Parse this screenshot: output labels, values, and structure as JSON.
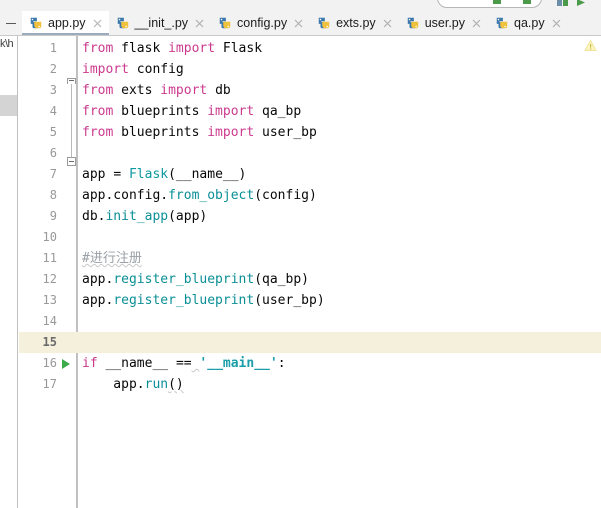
{
  "window": {
    "app": "PyCharm",
    "active_file": "app.py"
  },
  "toolbar": {
    "search_placeholder": "",
    "icons": [
      {
        "name": "run-config-icon",
        "color": "#4a9a4a"
      },
      {
        "name": "run-icon",
        "color": "#4a9a4a"
      },
      {
        "name": "flag-icon-1",
        "color": "#4a9a4a"
      },
      {
        "name": "flag-icon-2",
        "color": "#4a9a4a"
      }
    ]
  },
  "left_panel": {
    "clipped_label": "k\\h"
  },
  "tabs": {
    "hide_label": "",
    "close_label": "×",
    "items": [
      {
        "label": "app.py",
        "active": true
      },
      {
        "label": "__init_.py",
        "active": false
      },
      {
        "label": "config.py",
        "active": false
      },
      {
        "label": "exts.py",
        "active": false
      },
      {
        "label": "user.py",
        "active": false
      },
      {
        "label": "qa.py",
        "active": false
      }
    ]
  },
  "editor": {
    "language": "python",
    "current_line": 15,
    "run_marker_line": 16,
    "fold_lines": [
      1,
      5
    ],
    "warning_badge": "warning-triangle-icon",
    "line_count": 17,
    "lines": [
      {
        "n": 1,
        "tokens": [
          {
            "t": "from",
            "c": "kw2"
          },
          {
            "t": " flask ",
            "c": "plain"
          },
          {
            "t": "import",
            "c": "kw2"
          },
          {
            "t": " Flask",
            "c": "plain"
          }
        ]
      },
      {
        "n": 2,
        "tokens": [
          {
            "t": "import",
            "c": "kw2"
          },
          {
            "t": " config",
            "c": "plain"
          }
        ]
      },
      {
        "n": 3,
        "tokens": [
          {
            "t": "from",
            "c": "kw2"
          },
          {
            "t": " exts ",
            "c": "plain"
          },
          {
            "t": "import",
            "c": "kw2"
          },
          {
            "t": " db",
            "c": "plain"
          }
        ]
      },
      {
        "n": 4,
        "tokens": [
          {
            "t": "from",
            "c": "kw2"
          },
          {
            "t": " blueprints ",
            "c": "plain"
          },
          {
            "t": "import",
            "c": "kw2"
          },
          {
            "t": " qa_bp",
            "c": "plain"
          }
        ]
      },
      {
        "n": 5,
        "tokens": [
          {
            "t": "from",
            "c": "kw2"
          },
          {
            "t": " blueprints ",
            "c": "plain"
          },
          {
            "t": "import",
            "c": "kw2"
          },
          {
            "t": " user_bp",
            "c": "plain"
          }
        ]
      },
      {
        "n": 6,
        "tokens": []
      },
      {
        "n": 7,
        "tokens": [
          {
            "t": "app ",
            "c": "plain"
          },
          {
            "t": "=",
            "c": "plain"
          },
          {
            "t": " ",
            "c": "plain"
          },
          {
            "t": "Flask",
            "c": "cls"
          },
          {
            "t": "(__name__)",
            "c": "plain"
          }
        ]
      },
      {
        "n": 8,
        "tokens": [
          {
            "t": "app.config.",
            "c": "plain"
          },
          {
            "t": "from_object",
            "c": "fn"
          },
          {
            "t": "(config)",
            "c": "plain"
          }
        ]
      },
      {
        "n": 9,
        "tokens": [
          {
            "t": "db.",
            "c": "plain"
          },
          {
            "t": "init_app",
            "c": "fn"
          },
          {
            "t": "(app)",
            "c": "plain"
          }
        ]
      },
      {
        "n": 10,
        "tokens": []
      },
      {
        "n": 11,
        "tokens": [
          {
            "t": "#进行注册",
            "c": "cmt squig"
          }
        ]
      },
      {
        "n": 12,
        "tokens": [
          {
            "t": "app.",
            "c": "plain"
          },
          {
            "t": "register_blueprint",
            "c": "fn"
          },
          {
            "t": "(qa_bp)",
            "c": "plain"
          }
        ]
      },
      {
        "n": 13,
        "tokens": [
          {
            "t": "app.",
            "c": "plain"
          },
          {
            "t": "register_blueprint",
            "c": "fn"
          },
          {
            "t": "(user_bp)",
            "c": "plain"
          }
        ]
      },
      {
        "n": 14,
        "tokens": []
      },
      {
        "n": 15,
        "tokens": []
      },
      {
        "n": 16,
        "tokens": [
          {
            "t": "if",
            "c": "kw2"
          },
          {
            "t": " __name__ ",
            "c": "plain"
          },
          {
            "t": "==",
            "c": "plain"
          },
          {
            "t": " ",
            "c": "plain squig"
          },
          {
            "t": "'__main__'",
            "c": "str"
          },
          {
            "t": ":",
            "c": "plain"
          }
        ]
      },
      {
        "n": 17,
        "tokens": [
          {
            "t": "    app.",
            "c": "plain"
          },
          {
            "t": "run",
            "c": "fn"
          },
          {
            "t": "()",
            "c": "plain squig"
          }
        ]
      }
    ]
  }
}
